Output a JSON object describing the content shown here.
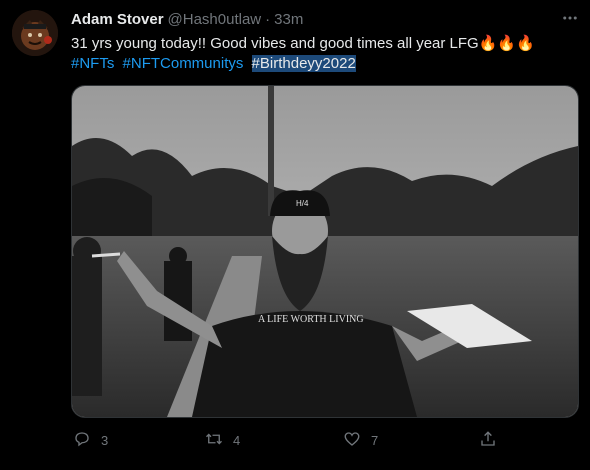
{
  "tweet": {
    "author_name": "Adam Stover",
    "handle": "@Hash0utlaw",
    "separator": "·",
    "time": "33m",
    "text": "31 yrs young today!! Good vibes and good times all year LFG🔥🔥🔥",
    "hashtags": [
      "#NFTs",
      "#NFTCommunitys",
      "#Birthdeyy2022"
    ],
    "image_text": "A LIFE WORTH LIVING",
    "cap_text": "H/4"
  },
  "actions": {
    "reply_count": "3",
    "retweet_count": "4",
    "like_count": "7"
  },
  "icons": {
    "more": "more-icon",
    "reply": "reply-icon",
    "retweet": "retweet-icon",
    "like": "heart-icon",
    "share": "share-icon"
  },
  "colors": {
    "background": "#000000",
    "text": "#e7e9ea",
    "secondary": "#71767b",
    "link": "#1d9bf0"
  }
}
